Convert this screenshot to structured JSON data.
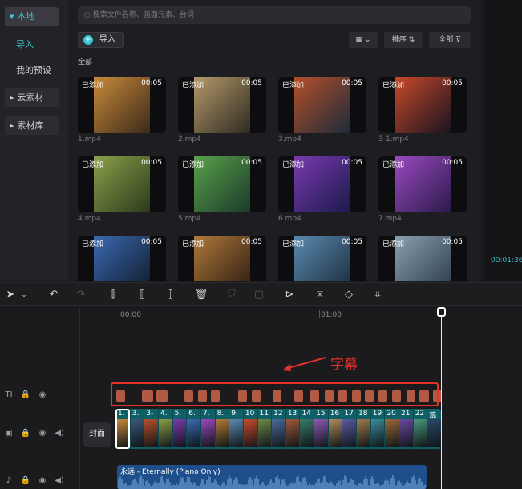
{
  "left_nav": {
    "local": "本地",
    "import": "导入",
    "presets": "我的预设",
    "cloud": "云素材",
    "library": "素材库"
  },
  "media": {
    "search_placeholder": "搜索文件名称、画面元素、台词",
    "import_label": "导入",
    "sort_label": "排序",
    "filter_label": "全部",
    "section_label": "全部",
    "items": [
      {
        "badge": "已添加",
        "duration": "00:05",
        "name": "1.mp4"
      },
      {
        "badge": "已添加",
        "duration": "00:05",
        "name": "2.mp4"
      },
      {
        "badge": "已添加",
        "duration": "00:05",
        "name": "3.mp4"
      },
      {
        "badge": "已添加",
        "duration": "00:05",
        "name": "3-1.mp4"
      },
      {
        "badge": "已添加",
        "duration": "00:05",
        "name": "4.mp4"
      },
      {
        "badge": "已添加",
        "duration": "00:05",
        "name": "5.mp4"
      },
      {
        "badge": "已添加",
        "duration": "00:05",
        "name": "6.mp4"
      },
      {
        "badge": "已添加",
        "duration": "00:05",
        "name": "7.mp4"
      },
      {
        "badge": "已添加",
        "duration": "00:05",
        "name": ""
      },
      {
        "badge": "已添加",
        "duration": "00:05",
        "name": ""
      },
      {
        "badge": "已添加",
        "duration": "00:05",
        "name": ""
      },
      {
        "badge": "已添加",
        "duration": "00:05",
        "name": ""
      }
    ]
  },
  "preview": {
    "timecode": "00:01:36"
  },
  "timeline": {
    "ruler": [
      "00:00",
      "01:00"
    ],
    "cover_label": "封面",
    "callout": "字幕",
    "video_clips": [
      "1.",
      "3.",
      "3-",
      "4.",
      "5.",
      "6.",
      "7.",
      "8.",
      "9.",
      "10",
      "11",
      "12",
      "13",
      "14",
      "15",
      "16",
      "17",
      "18",
      "19",
      "20",
      "21",
      "22",
      "篇"
    ],
    "subtitle_clip_count": 21,
    "audio_title": "永远 - Eternally (Piano Only)"
  },
  "colors": {
    "accent": "#3fd0d8",
    "subtitle_clip": "#b25a44",
    "highlight_box": "#e2322a",
    "video_track": "#0f5f66",
    "audio_track": "#1f4f8a"
  }
}
